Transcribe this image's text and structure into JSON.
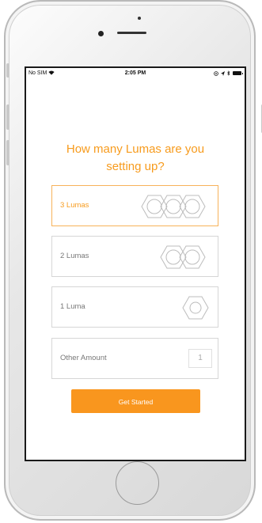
{
  "statusbar": {
    "carrier": "No SIM",
    "wifi_icon": "wifi-icon",
    "time": "2:05 PM",
    "right_icons": [
      "lock-rotation-icon",
      "location-arrow-icon",
      "bluetooth-icon",
      "battery-icon"
    ]
  },
  "screen": {
    "title_line1": "How many Lumas are you",
    "title_line2": "setting up?"
  },
  "options": [
    {
      "label": "3 Lumas",
      "icon": "three-hexagons-icon",
      "selected": true
    },
    {
      "label": "2 Lumas",
      "icon": "two-hexagons-icon",
      "selected": false
    },
    {
      "label": "1 Luma",
      "icon": "one-hexagon-icon",
      "selected": false
    },
    {
      "label": "Other Amount",
      "value": "1",
      "selected": false
    }
  ],
  "primary_button": {
    "label": "Get Started"
  },
  "colors": {
    "accent": "#f79b1d",
    "button": "#f9961e",
    "border": "#d6d6d6",
    "selected_border": "#f7b25a"
  }
}
